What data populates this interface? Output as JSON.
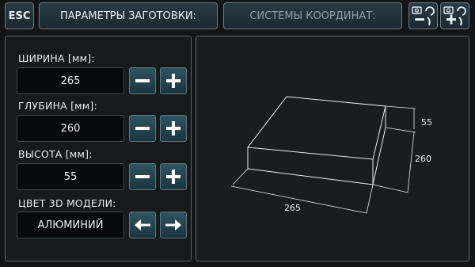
{
  "toolbar": {
    "esc_label": "ESC",
    "params_label": "ПАРАМЕТРЫ ЗАГОТОВКИ:",
    "coords_label": "СИСТЕМЫ КООРДИНАТ:",
    "zoom_out_icon": "camera-zoom-out-icon",
    "zoom_in_icon": "camera-zoom-in-icon"
  },
  "fields": [
    {
      "label": "ШИРИНА [мм]:",
      "value": "265"
    },
    {
      "label": "ГЛУБИНА [мм]:",
      "value": "260"
    },
    {
      "label": "ВЫСОТА [мм]:",
      "value": "55"
    }
  ],
  "material": {
    "label": "ЦВЕТ 3D МОДЕЛИ:",
    "value": "АЛЮМИНИЙ"
  },
  "preview": {
    "width": "265",
    "depth": "260",
    "height": "55"
  },
  "colors": {
    "accent_button": "#24434d",
    "panel_border": "#586870",
    "background": "#121416"
  }
}
